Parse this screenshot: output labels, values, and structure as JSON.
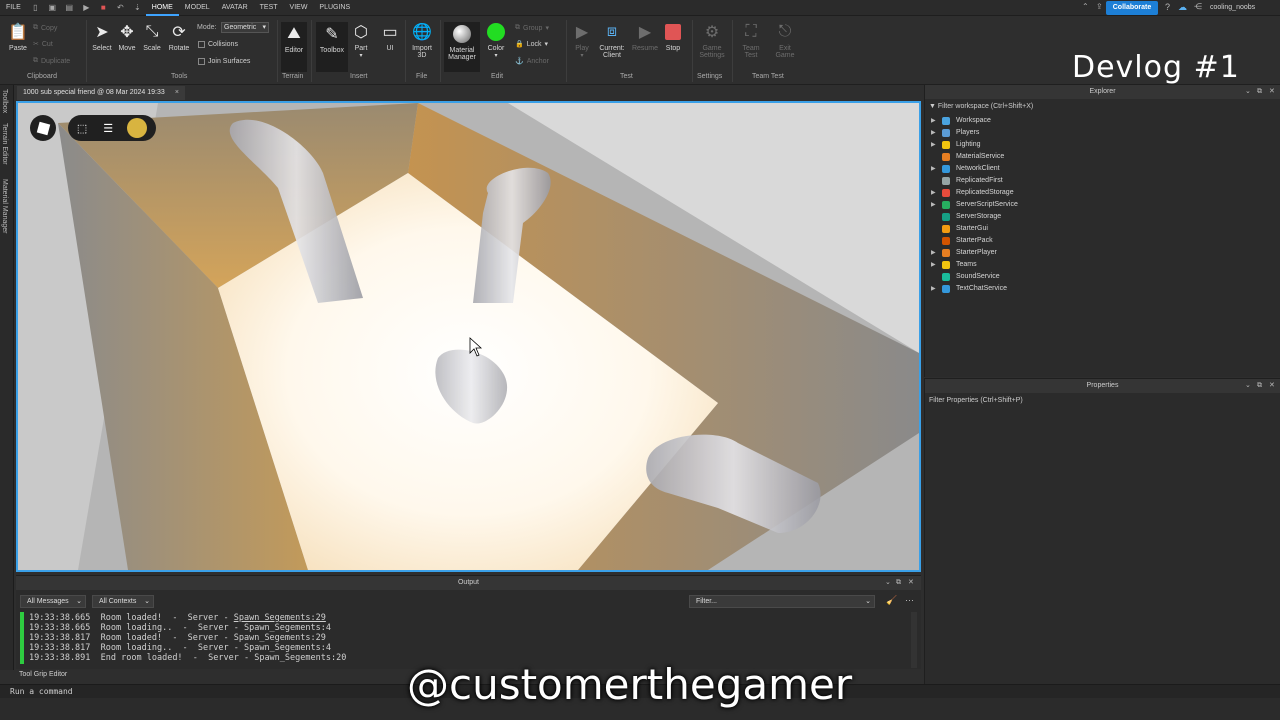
{
  "menubar": {
    "menus": [
      "FILE",
      "HOME",
      "MODEL",
      "AVATAR",
      "TEST",
      "VIEW",
      "PLUGINS"
    ],
    "active": "HOME",
    "collaborate_label": "Collaborate",
    "username": "cooling_noobs"
  },
  "ribbon": {
    "clipboard": {
      "paste": "Paste",
      "copy": "Copy",
      "cut": "Cut",
      "duplicate": "Duplicate",
      "label": "Clipboard"
    },
    "tools": {
      "select": "Select",
      "move": "Move",
      "scale": "Scale",
      "rotate": "Rotate",
      "mode_label": "Mode:",
      "mode_value": "Geometric",
      "collisions": "Collisions",
      "join_surfaces": "Join Surfaces",
      "label": "Tools"
    },
    "terrain": {
      "editor": "Editor",
      "label": "Terrain"
    },
    "insert": {
      "toolbox": "Toolbox",
      "part": "Part",
      "ui": "UI",
      "label": "Insert"
    },
    "file": {
      "import3d_1": "Import",
      "import3d_2": "3D",
      "label": "File"
    },
    "edit": {
      "material_1": "Material",
      "material_2": "Manager",
      "color": "Color",
      "group": "Group",
      "lock": "Lock",
      "anchor": "Anchor",
      "label": "Edit"
    },
    "test": {
      "play": "Play",
      "current_1": "Current:",
      "current_2": "Client",
      "resume": "Resume",
      "stop": "Stop",
      "label": "Test"
    },
    "settings": {
      "game_1": "Game",
      "game_2": "Settings",
      "label": "Settings"
    },
    "team_test": {
      "team_1": "Team",
      "team_2": "Test",
      "exit_1": "Exit",
      "exit_2": "Game",
      "label": "Team Test"
    }
  },
  "overlay_title": "Devlog #1",
  "left_tabs": [
    "Toolbox",
    "Terrain Editor",
    "Material Manager"
  ],
  "doc_tab": {
    "title": "1000 sub special friend @ 08 Mar 2024 19:33",
    "close": "×"
  },
  "output": {
    "title": "Output",
    "filter_messages": "All Messages",
    "filter_contexts": "All Contexts",
    "filter_placeholder": "Filter...",
    "lines": [
      {
        "time": "19:33:38.665",
        "msg": "Room loaded!  -  Server - ",
        "src": "Spawn_Segements:29",
        "link": true
      },
      {
        "time": "19:33:38.665",
        "msg": "Room loading..  -  Server - ",
        "src": "Spawn_Segements:4",
        "link": false
      },
      {
        "time": "19:33:38.817",
        "msg": "Room loaded!  -  Server - ",
        "src": "Spawn_Segements:29",
        "link": false
      },
      {
        "time": "19:33:38.817",
        "msg": "Room loading..  -  Server - ",
        "src": "Spawn_Segements:4",
        "link": false
      },
      {
        "time": "19:33:38.891",
        "msg": "End room loaded!  -  Server - ",
        "src": "Spawn_Segements:20",
        "link": false
      }
    ]
  },
  "tool_grip_label": "Tool Grip Editor",
  "command_bar_placeholder": "Run a command",
  "watermark": "@customerthegamer",
  "explorer": {
    "title": "Explorer",
    "filter": "Filter workspace (Ctrl+Shift+X)",
    "items": [
      {
        "label": "Workspace",
        "arrow": true,
        "color": "#4aa3df"
      },
      {
        "label": "Players",
        "arrow": true,
        "color": "#5b9bd5"
      },
      {
        "label": "Lighting",
        "arrow": true,
        "color": "#f1c40f"
      },
      {
        "label": "MaterialService",
        "arrow": false,
        "color": "#e67e22"
      },
      {
        "label": "NetworkClient",
        "arrow": true,
        "color": "#3498db"
      },
      {
        "label": "ReplicatedFirst",
        "arrow": false,
        "color": "#95a5a6"
      },
      {
        "label": "ReplicatedStorage",
        "arrow": true,
        "color": "#e74c3c"
      },
      {
        "label": "ServerScriptService",
        "arrow": true,
        "color": "#27ae60"
      },
      {
        "label": "ServerStorage",
        "arrow": false,
        "color": "#16a085"
      },
      {
        "label": "StarterGui",
        "arrow": false,
        "color": "#f39c12"
      },
      {
        "label": "StarterPack",
        "arrow": false,
        "color": "#d35400"
      },
      {
        "label": "StarterPlayer",
        "arrow": true,
        "color": "#e67e22"
      },
      {
        "label": "Teams",
        "arrow": true,
        "color": "#f1c40f"
      },
      {
        "label": "SoundService",
        "arrow": false,
        "color": "#1abc9c"
      },
      {
        "label": "TextChatService",
        "arrow": true,
        "color": "#3498db"
      }
    ]
  },
  "properties": {
    "title": "Properties",
    "filter": "Filter Properties (Ctrl+Shift+P)"
  },
  "colors": {
    "accent": "#1d7fd6",
    "viewport_border": "#3aa0e8",
    "log_bar": "#2ecc40",
    "stop": "#e05555",
    "color_swatch": "#22dd22"
  }
}
